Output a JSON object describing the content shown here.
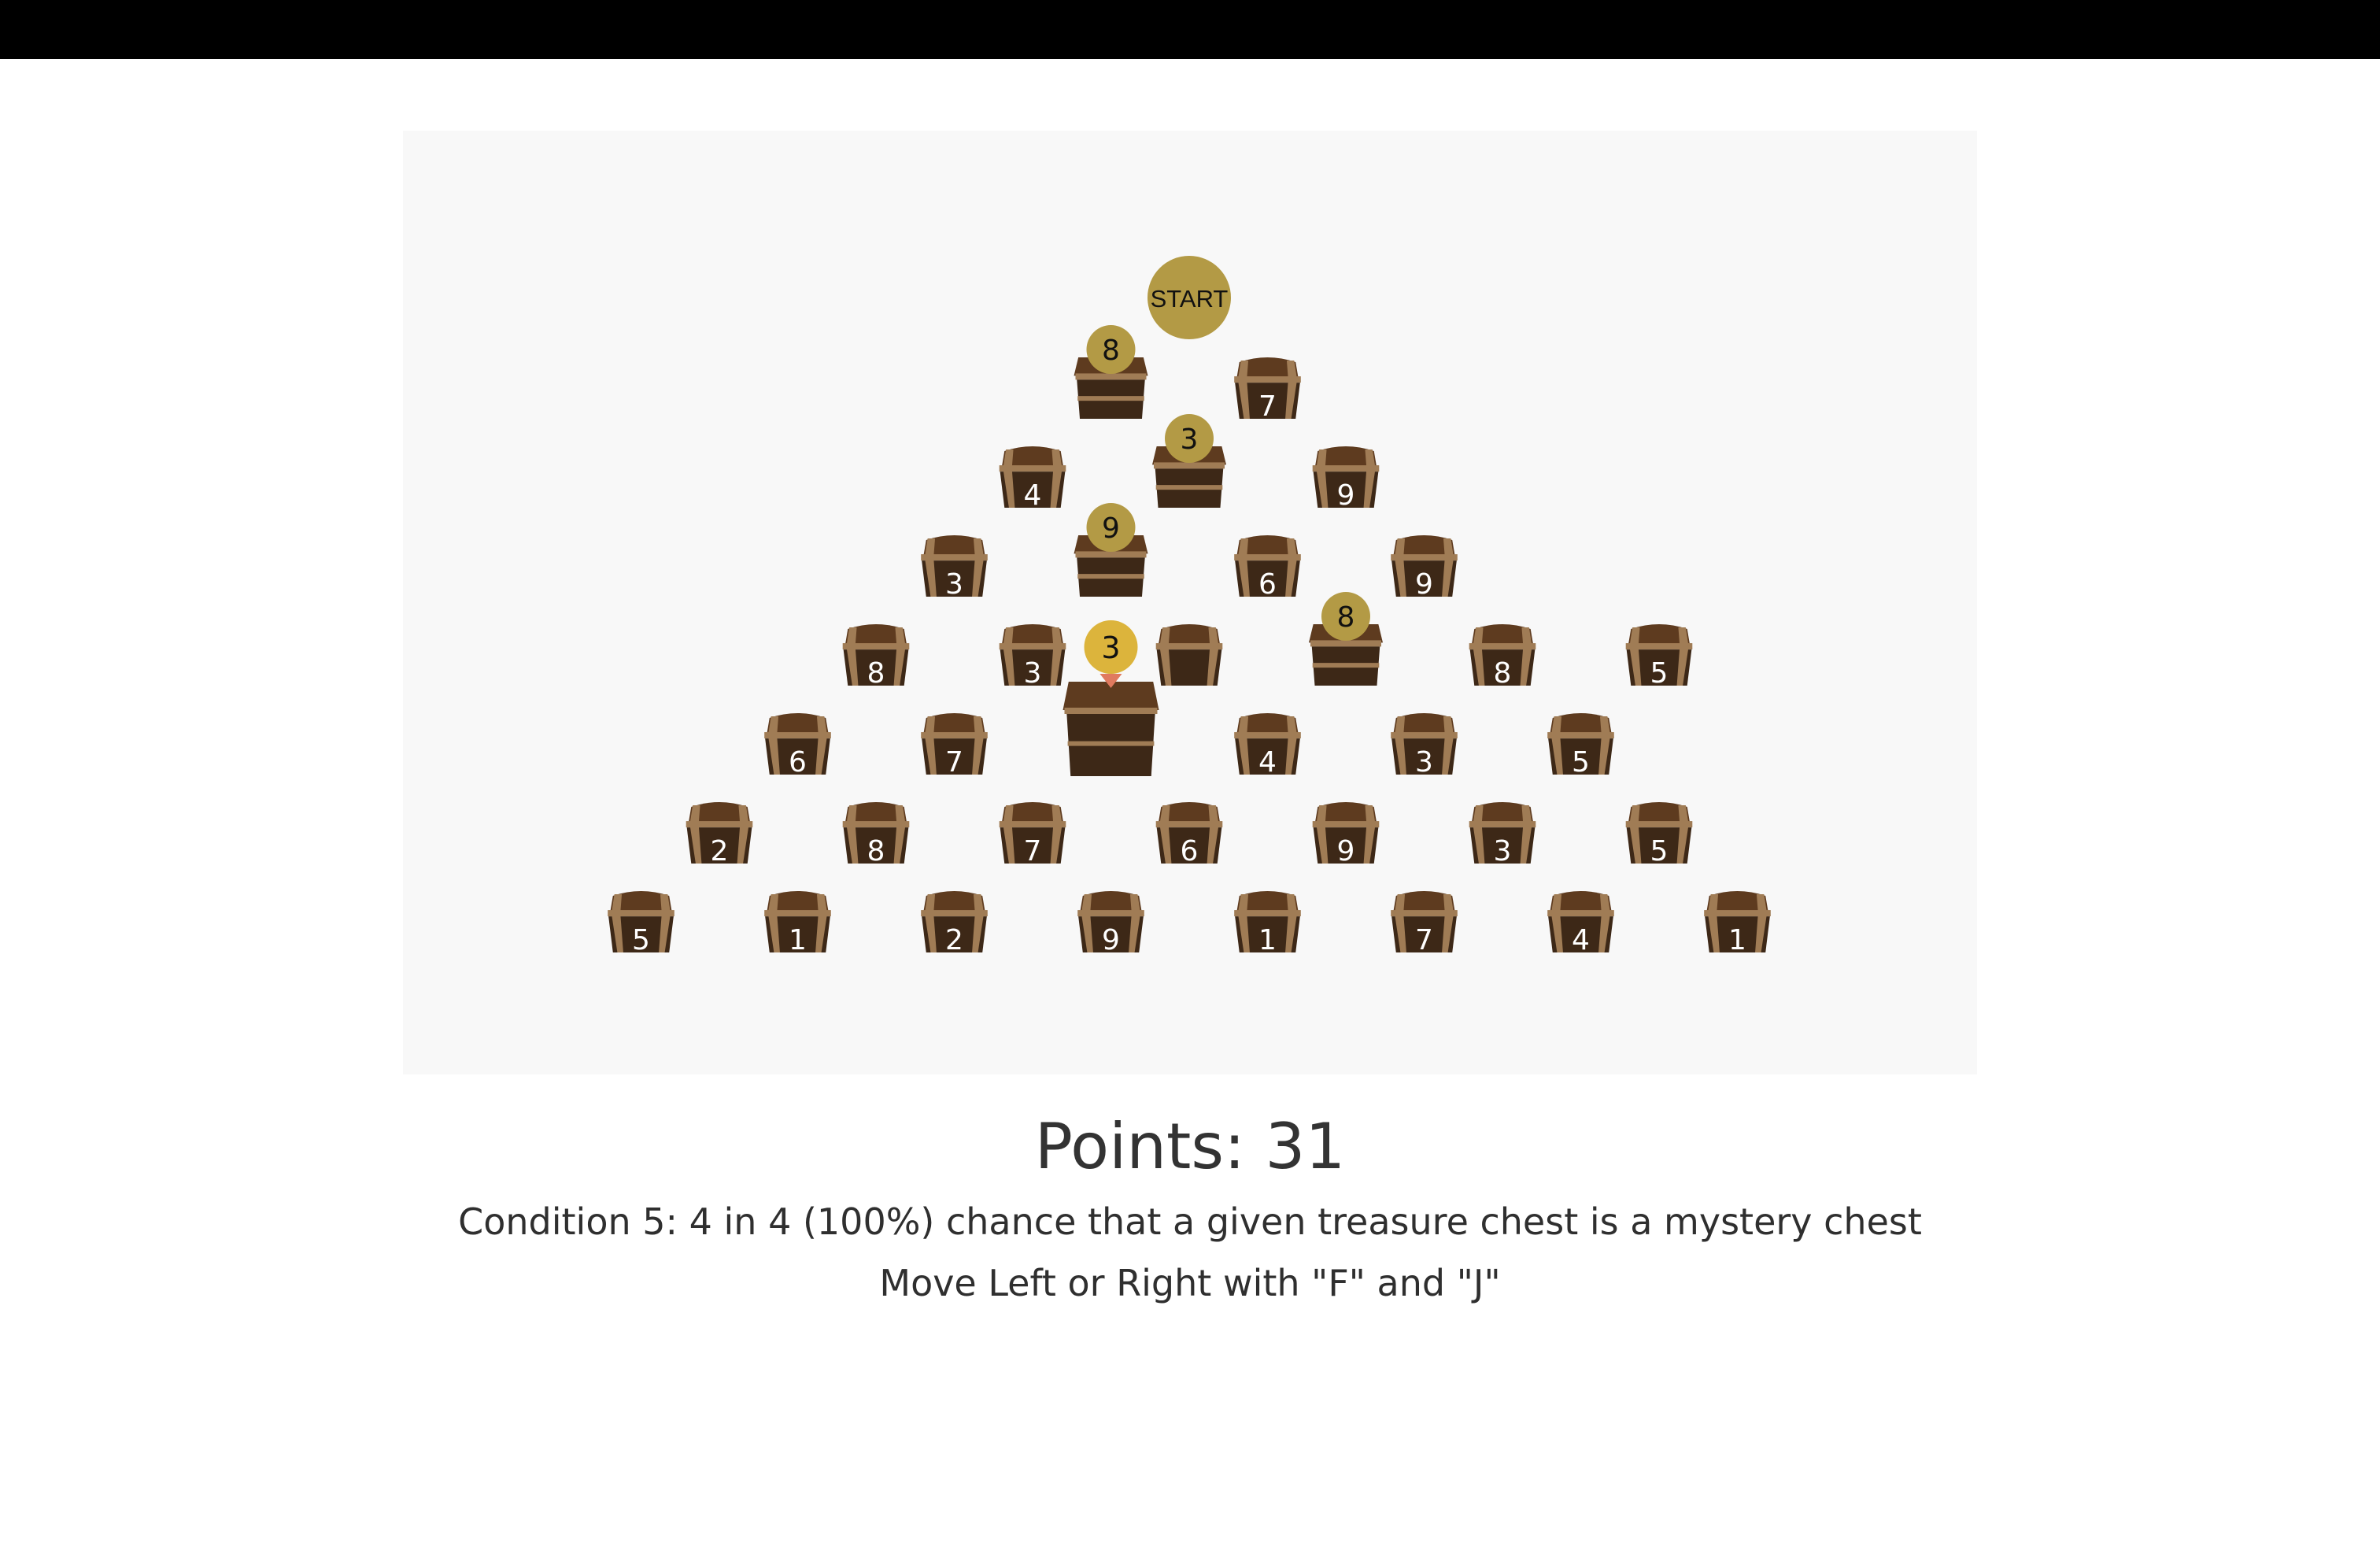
{
  "start_label": "START",
  "points_text": "Points: 31",
  "condition_text": "Condition 5: 4 in 4 (100%) chance that a given treasure chest is a mystery chest",
  "instructions_text": "Move Left or Right with \"F\" and \"J\"",
  "colors": {
    "board": "#f8f8f8",
    "coin": "#b39a45",
    "current_coin": "#dcb43c",
    "marker_tip": "#e07a5f",
    "chest_dark": "#3d2817",
    "chest_mid": "#5e3b1f",
    "chest_light": "#a07c55"
  },
  "pyramid": [
    [
      {
        "value": "8",
        "open": true
      },
      {
        "value": "7",
        "open": false
      }
    ],
    [
      {
        "value": "4",
        "open": false
      },
      {
        "value": "3",
        "open": true
      },
      {
        "value": "9",
        "open": false
      }
    ],
    [
      {
        "value": "3",
        "open": false
      },
      {
        "value": "9",
        "open": true
      },
      {
        "value": "6",
        "open": false
      },
      {
        "value": "9",
        "open": false
      }
    ],
    [
      {
        "value": "8",
        "open": false
      },
      {
        "value": "3",
        "open": false
      },
      {
        "value": "",
        "open": false
      },
      {
        "value": "8",
        "open": true
      },
      {
        "value": "8",
        "open": false
      },
      {
        "value": "5",
        "open": false
      }
    ],
    [
      {
        "value": "6",
        "open": false
      },
      {
        "value": "7",
        "open": false
      },
      {
        "value": "",
        "open": false,
        "current": true
      },
      {
        "value": "4",
        "open": false
      },
      {
        "value": "3",
        "open": false
      },
      {
        "value": "5",
        "open": false
      }
    ],
    [
      {
        "value": "2",
        "open": false
      },
      {
        "value": "8",
        "open": false
      },
      {
        "value": "7",
        "open": false
      },
      {
        "value": "6",
        "open": false
      },
      {
        "value": "9",
        "open": false
      },
      {
        "value": "3",
        "open": false
      },
      {
        "value": "5",
        "open": false
      }
    ],
    [
      {
        "value": "5",
        "open": false
      },
      {
        "value": "1",
        "open": false
      },
      {
        "value": "2",
        "open": false
      },
      {
        "value": "9",
        "open": false
      },
      {
        "value": "1",
        "open": false
      },
      {
        "value": "7",
        "open": false
      },
      {
        "value": "4",
        "open": false
      },
      {
        "value": "1",
        "open": false
      }
    ]
  ],
  "current_marker_value": "3"
}
